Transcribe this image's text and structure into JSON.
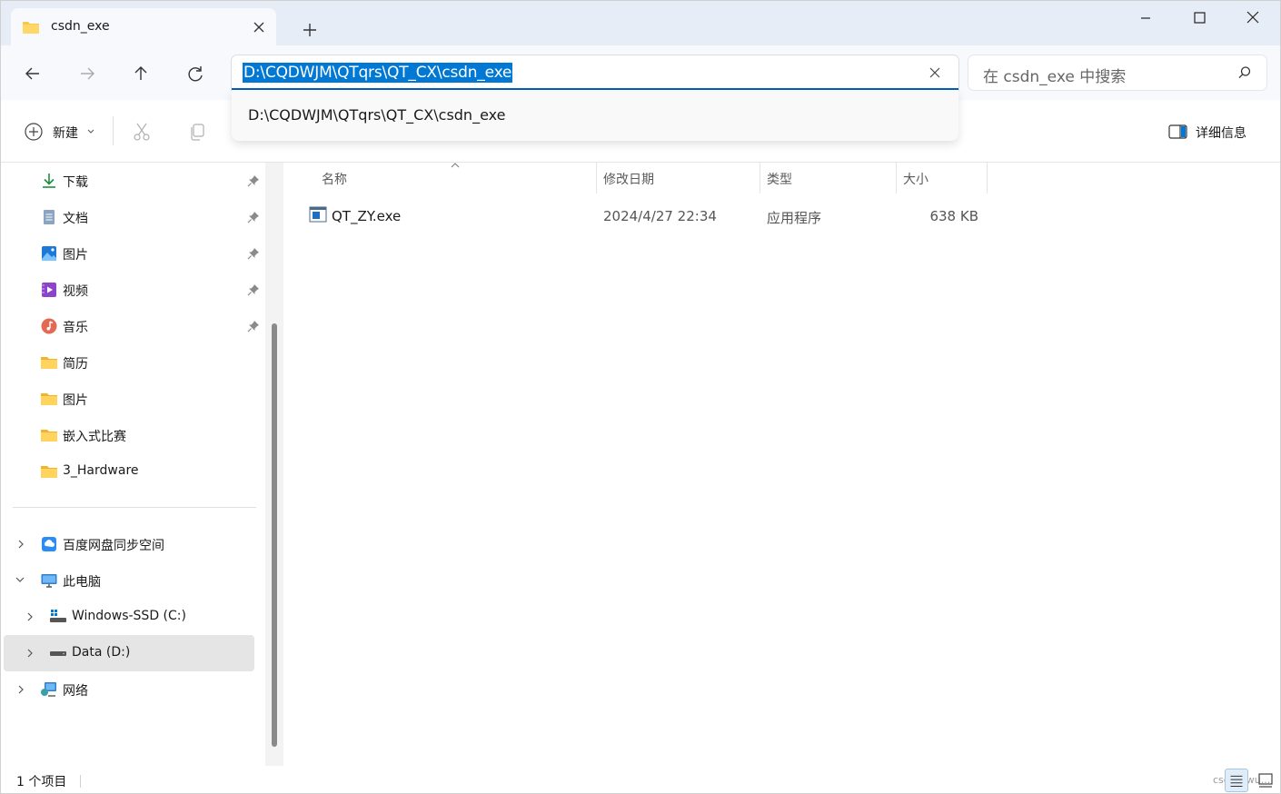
{
  "window": {
    "tab_title": "csdn_exe",
    "icons": {
      "minimize": "minimize-icon",
      "maximize": "maximize-icon",
      "close": "close-icon"
    }
  },
  "nav": {
    "address_path": "D:\\CQDWJM\\QTqrs\\QT_CX\\csdn_exe",
    "address_suggestion": "D:\\CQDWJM\\QTqrs\\QT_CX\\csdn_exe",
    "search_placeholder": "在 csdn_exe 中搜索"
  },
  "toolbar": {
    "new_label": "新建",
    "details_label": "详细信息"
  },
  "sidebar": {
    "quick_access": [
      {
        "label": "下载",
        "icon": "download-icon",
        "pinned": true
      },
      {
        "label": "文档",
        "icon": "document-icon",
        "pinned": true
      },
      {
        "label": "图片",
        "icon": "pictures-icon",
        "pinned": true
      },
      {
        "label": "视频",
        "icon": "video-icon",
        "pinned": true
      },
      {
        "label": "音乐",
        "icon": "music-icon",
        "pinned": true
      },
      {
        "label": "简历",
        "icon": "folder-icon",
        "pinned": false
      },
      {
        "label": "图片",
        "icon": "folder-icon",
        "pinned": false
      },
      {
        "label": "嵌入式比赛",
        "icon": "folder-icon",
        "pinned": false
      },
      {
        "label": "3_Hardware",
        "icon": "folder-icon",
        "pinned": false
      }
    ],
    "tree": [
      {
        "label": "百度网盘同步空间",
        "icon": "baidu-cloud-icon",
        "expanded": false
      },
      {
        "label": "此电脑",
        "icon": "computer-icon",
        "expanded": true
      },
      {
        "label": "Windows-SSD (C:)",
        "icon": "windows-drive-icon",
        "expanded": false
      },
      {
        "label": "Data (D:)",
        "icon": "drive-icon",
        "expanded": false,
        "selected": true
      },
      {
        "label": "网络",
        "icon": "network-icon",
        "expanded": false
      }
    ]
  },
  "table": {
    "columns": [
      "名称",
      "修改日期",
      "类型",
      "大小"
    ],
    "rows": [
      {
        "name": "QT_ZY.exe",
        "date": "2024/4/27 22:34",
        "type": "应用程序",
        "size": "638 KB"
      }
    ]
  },
  "status": {
    "item_count": "1 个项目",
    "watermark": "csdn@wu..."
  },
  "colors": {
    "accent": "#0078d4",
    "titlebar": "#e7edf6",
    "navbar": "#f7f9fc",
    "selected_row": "#e5e5e5"
  }
}
